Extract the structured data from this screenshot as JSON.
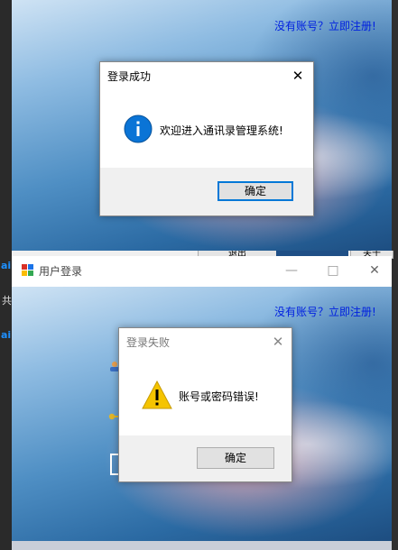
{
  "window1": {
    "register_link": "没有账号？立即注册!",
    "peek_buttons": [
      "退出",
      "关于"
    ]
  },
  "window2": {
    "title": "用户登录",
    "register_link": "没有账号？立即注册!",
    "left_fragments": [
      "ai",
      "共",
      "ai"
    ]
  },
  "success_dialog": {
    "title": "登录成功",
    "message": "欢迎进入通讯录管理系统!",
    "ok_label": "确定",
    "icon": "info-icon"
  },
  "fail_dialog": {
    "title": "登录失败",
    "message": "账号或密码错误!",
    "ok_label": "确定",
    "icon": "warning-icon"
  },
  "colors": {
    "link": "#0020e0",
    "accent": "#0078d7",
    "info": "#0a74d6",
    "warning": "#f5c400"
  }
}
